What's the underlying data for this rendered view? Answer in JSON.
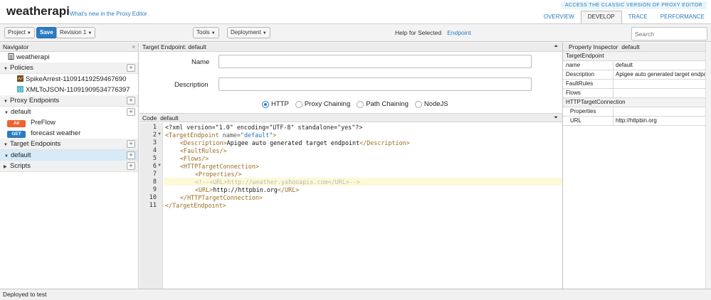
{
  "header": {
    "title": "weatherapi",
    "whats_new": "What's new in the Proxy Editor",
    "classic_link": "ACCESS THE CLASSIC VERSION OF PROXY EDITOR",
    "tabs": [
      {
        "label": "OVERVIEW",
        "active": false
      },
      {
        "label": "DEVELOP",
        "active": true
      },
      {
        "label": "TRACE",
        "active": false
      },
      {
        "label": "PERFORMANCE",
        "active": false
      }
    ]
  },
  "toolbar": {
    "project_label": "Project",
    "save_label": "Save",
    "revision_label": "Revision 1",
    "tools_label": "Tools",
    "deployment_label": "Deployment",
    "help_label": "Help for Selected",
    "help_link": "Endpoint",
    "search_placeholder": "Search"
  },
  "navigator": {
    "title": "Navigator",
    "collapse": "«",
    "proxy_name": "weatherapi",
    "policies_label": "Policies",
    "policies": [
      "SpikeArrest-1109141925946769​0",
      "XMLToJSON-1109190953477639​7"
    ],
    "proxy_endpoints_label": "Proxy Endpoints",
    "proxy_default": "default",
    "flows": [
      {
        "verb": "All",
        "name": "PreFlow",
        "color": "#f0612e"
      },
      {
        "verb": "GET",
        "name": "forecast weather",
        "color": "#2a7bc5"
      }
    ],
    "target_endpoints_label": "Target Endpoints",
    "target_default": "default",
    "scripts_label": "Scripts"
  },
  "editor": {
    "header": "Target Endpoint: default",
    "name_label": "Name",
    "name_value": "",
    "description_label": "Description",
    "description_value": "",
    "radios": [
      {
        "label": "HTTP",
        "selected": true
      },
      {
        "label": "Proxy Chaining",
        "selected": false
      },
      {
        "label": "Path Chaining",
        "selected": false
      },
      {
        "label": "NodeJS",
        "selected": false
      }
    ],
    "code_label": "Code",
    "code_file": "default",
    "line_numbers": [
      "1",
      "2",
      "3",
      "4",
      "5",
      "6",
      "7",
      "8",
      "9",
      "10",
      "11"
    ],
    "code": {
      "l1a": "<?xml version=\"1.0\" encoding=\"UTF-8\" standalone=\"yes\"?>",
      "l2_tag": "<TargetEndpoint",
      "l2_attr": " name=",
      "l2_val": "\"default\"",
      "l2_close": ">",
      "l3_open": "<Description>",
      "l3_text": "Apigee auto generated target endpoint",
      "l3_close": "</Description>",
      "l4": "<FaultRules/>",
      "l5": "<Flows/>",
      "l6": "<HTTPTargetConnection>",
      "l7": "<Properties/>",
      "l8": "<!--<URL>http://weather.yahooapis.com</URL>-->",
      "l9_open": "<URL>",
      "l9_text": "http://httpbin.org",
      "l9_close": "</URL>",
      "l10": "</HTTPTargetConnection>",
      "l11": "</TargetEndpoint>"
    }
  },
  "inspector": {
    "title": "Property Inspector",
    "subject": "default",
    "rows": [
      {
        "key": "TargetEndpoint",
        "value": "",
        "type": "group"
      },
      {
        "key": "name",
        "value": "default",
        "type": "italic"
      },
      {
        "key": "Description",
        "value": "Apigee auto generated target endpoint",
        "type": "plain"
      },
      {
        "key": "FaultRules",
        "value": "",
        "type": "plain"
      },
      {
        "key": "Flows",
        "value": "",
        "type": "plain"
      },
      {
        "key": "HTTPTargetConnection",
        "value": "",
        "type": "group"
      },
      {
        "key": "Properties",
        "value": "",
        "type": "indent"
      },
      {
        "key": "URL",
        "value": "http://httpbin.org",
        "type": "indent"
      }
    ]
  },
  "status": {
    "text": "Deployed to test"
  },
  "colors": {
    "accent": "#2a7bc5",
    "link": "#2a7bbd",
    "selected_row": "#d6eaf7",
    "highlight_line": "#fdf9d6"
  }
}
